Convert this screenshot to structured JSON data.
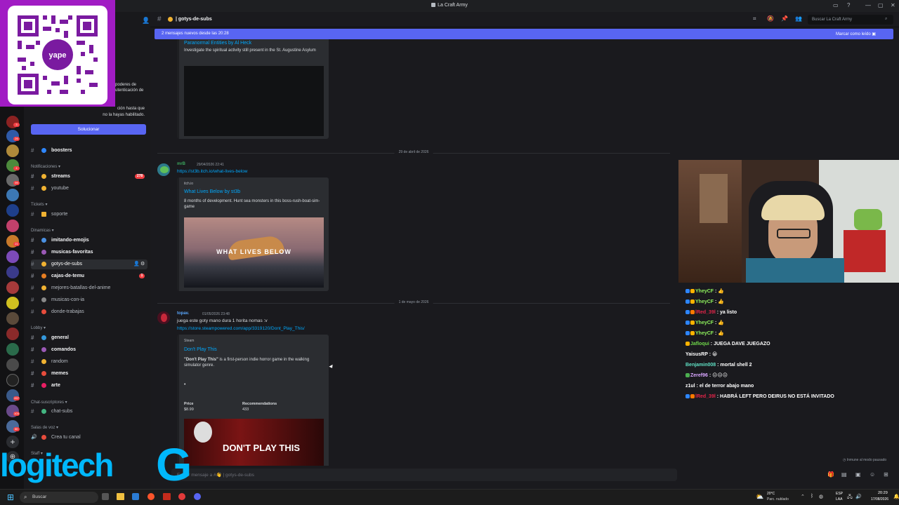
{
  "window": {
    "title": "La Craft Army"
  },
  "auth_prompt": {
    "text_line1": "poderes de",
    "text_line2": "utenticación de",
    "text_line3": "ción hasta que",
    "text_line4": "no la hayas habilitado.",
    "button": "Solucionar"
  },
  "channels": {
    "boosters": "boosters",
    "notifications_section": "Notificaciones",
    "streams": "streams",
    "streams_badge": "278",
    "youtube": "youtube",
    "tickets_section": "Tickets",
    "soporte": "soporte",
    "dinamicas_section": "Dinamicas",
    "imitando": "imitando-emojis",
    "musicas_fav": "musicas-favoritas",
    "gotys": "gotys-de-subs",
    "cajas": "cajas-de-temu",
    "cajas_badge": "1",
    "batallas": "mejores-batallas-del-anime",
    "musicas_ia": "musicas-con-ia",
    "donde": "donde-trabajas",
    "lobby_section": "Lobby",
    "general": "general",
    "comandos": "comandos",
    "random": "random",
    "memes": "memes",
    "arte": "arte",
    "chatsubs_section": "Chat-suscriptores",
    "chatsubs": "chat-subs",
    "voz_section": "Salas de voz",
    "crea": "Crea tu canal",
    "staff_section": "Staff"
  },
  "server_badges": [
    "3",
    "26",
    "4",
    "99",
    "4",
    "32",
    "21",
    "26",
    "3",
    "4",
    "17",
    "12",
    "44",
    "20",
    "267",
    "103",
    "5K"
  ],
  "header": {
    "channel": "gotys-de-subs",
    "search_placeholder": "Buscar La Craft Army"
  },
  "banner": {
    "text": "2 mensajes nuevos desde las 20:28",
    "mark_read": "Marcar como leído"
  },
  "messages": {
    "embed0_title": "Paranormal Entities by Al Heck",
    "embed0_desc": "Investigate the spiritual activity still present in the St. Augustine Asylum",
    "divider1": "29 de abril de 2026",
    "msg1_author": "mrB",
    "msg1_time": "29/04/2026 22:41",
    "msg1_link": "https://st3b.itch.io/what-lives-below",
    "embed1_provider": "itch.io",
    "embed1_title": "What Lives Below by st3b",
    "embed1_desc": "8 months of development. Hunt sea monsters in this boss-rush-boat-sim-game",
    "embed1_image_text": "WHAT LIVES BELOW",
    "divider2": "1 de mayo de 2026",
    "msg2_author": "topav.",
    "msg2_time": "01/05/2026 23:48",
    "msg2_text": "juega este goty mano dura 1 horita nomas :v",
    "msg2_link": "https://store.steampowered.com/app/3319120/Dont_Play_This/",
    "embed2_provider": "Steam",
    "embed2_title": "Don't Play This",
    "embed2_desc_bold": "\"Don't Play This\"",
    "embed2_desc": " is a first-person indie horror game in the walking simulator genre.",
    "embed2_price_label": "Price",
    "embed2_price": "$8.99",
    "embed2_rec_label": "Recommendations",
    "embed2_rec": "433",
    "embed2_image_text": "DON'T PLAY THIS"
  },
  "composer": {
    "placeholder": "Enviar mensaje a #👋 | gotys-de-subs",
    "mode": "Inmune al modo pausado"
  },
  "twitch_chat": [
    {
      "user": "YheyCF",
      "color": "#8ef15c",
      "msg": "👍",
      "icons": [
        "#2e86ff",
        "#ffb300"
      ]
    },
    {
      "user": "YheyCF",
      "color": "#8ef15c",
      "msg": "👍",
      "icons": [
        "#2e86ff",
        "#ffb300"
      ]
    },
    {
      "user": "lRed_39l",
      "color": "#e3254a",
      "msg": "ya listo",
      "icons": [
        "#2e86ff",
        "#ff7a00"
      ]
    },
    {
      "user": "YheyCF",
      "color": "#8ef15c",
      "msg": "👍",
      "icons": [
        "#2e86ff",
        "#ffb300"
      ]
    },
    {
      "user": "YheyCF",
      "color": "#8ef15c",
      "msg": "👍",
      "icons": [
        "#2e86ff",
        "#ffb300"
      ]
    },
    {
      "user": "Jafloqui",
      "color": "#6fd84a",
      "msg": "JUEGA DAVE JUEGAZO",
      "icons": [
        "#ffb300"
      ]
    },
    {
      "user": "YaisusRP",
      "color": "#ffffff",
      "msg": "😀",
      "icons": []
    },
    {
      "user": "Benjamin008",
      "color": "#5fe0c4",
      "msg": "mortal shell 2",
      "icons": []
    },
    {
      "user": "Zeref96",
      "color": "#d8a6ff",
      "msg": "😐😐😐",
      "icons": [
        "#4caf50"
      ]
    },
    {
      "user": "z1ul",
      "color": "#ffffff",
      "msg": "el de terror abajo mano",
      "icons": []
    },
    {
      "user": "lRed_39l",
      "color": "#e3254a",
      "msg": "HABRÁ LEFT PERO DEIRUS NO ESTÁ INVITADO",
      "icons": [
        "#2e86ff",
        "#ff7a00"
      ]
    }
  ],
  "taskbar": {
    "search": "Buscar",
    "weather_temp": "20°C",
    "weather_desc": "Parc. nublado",
    "lang1": "ESP",
    "lang2": "LAA",
    "time": "20:29",
    "date": "17/08/2026"
  },
  "overlay": {
    "logo_text": "logitech",
    "logo_g": "G"
  }
}
